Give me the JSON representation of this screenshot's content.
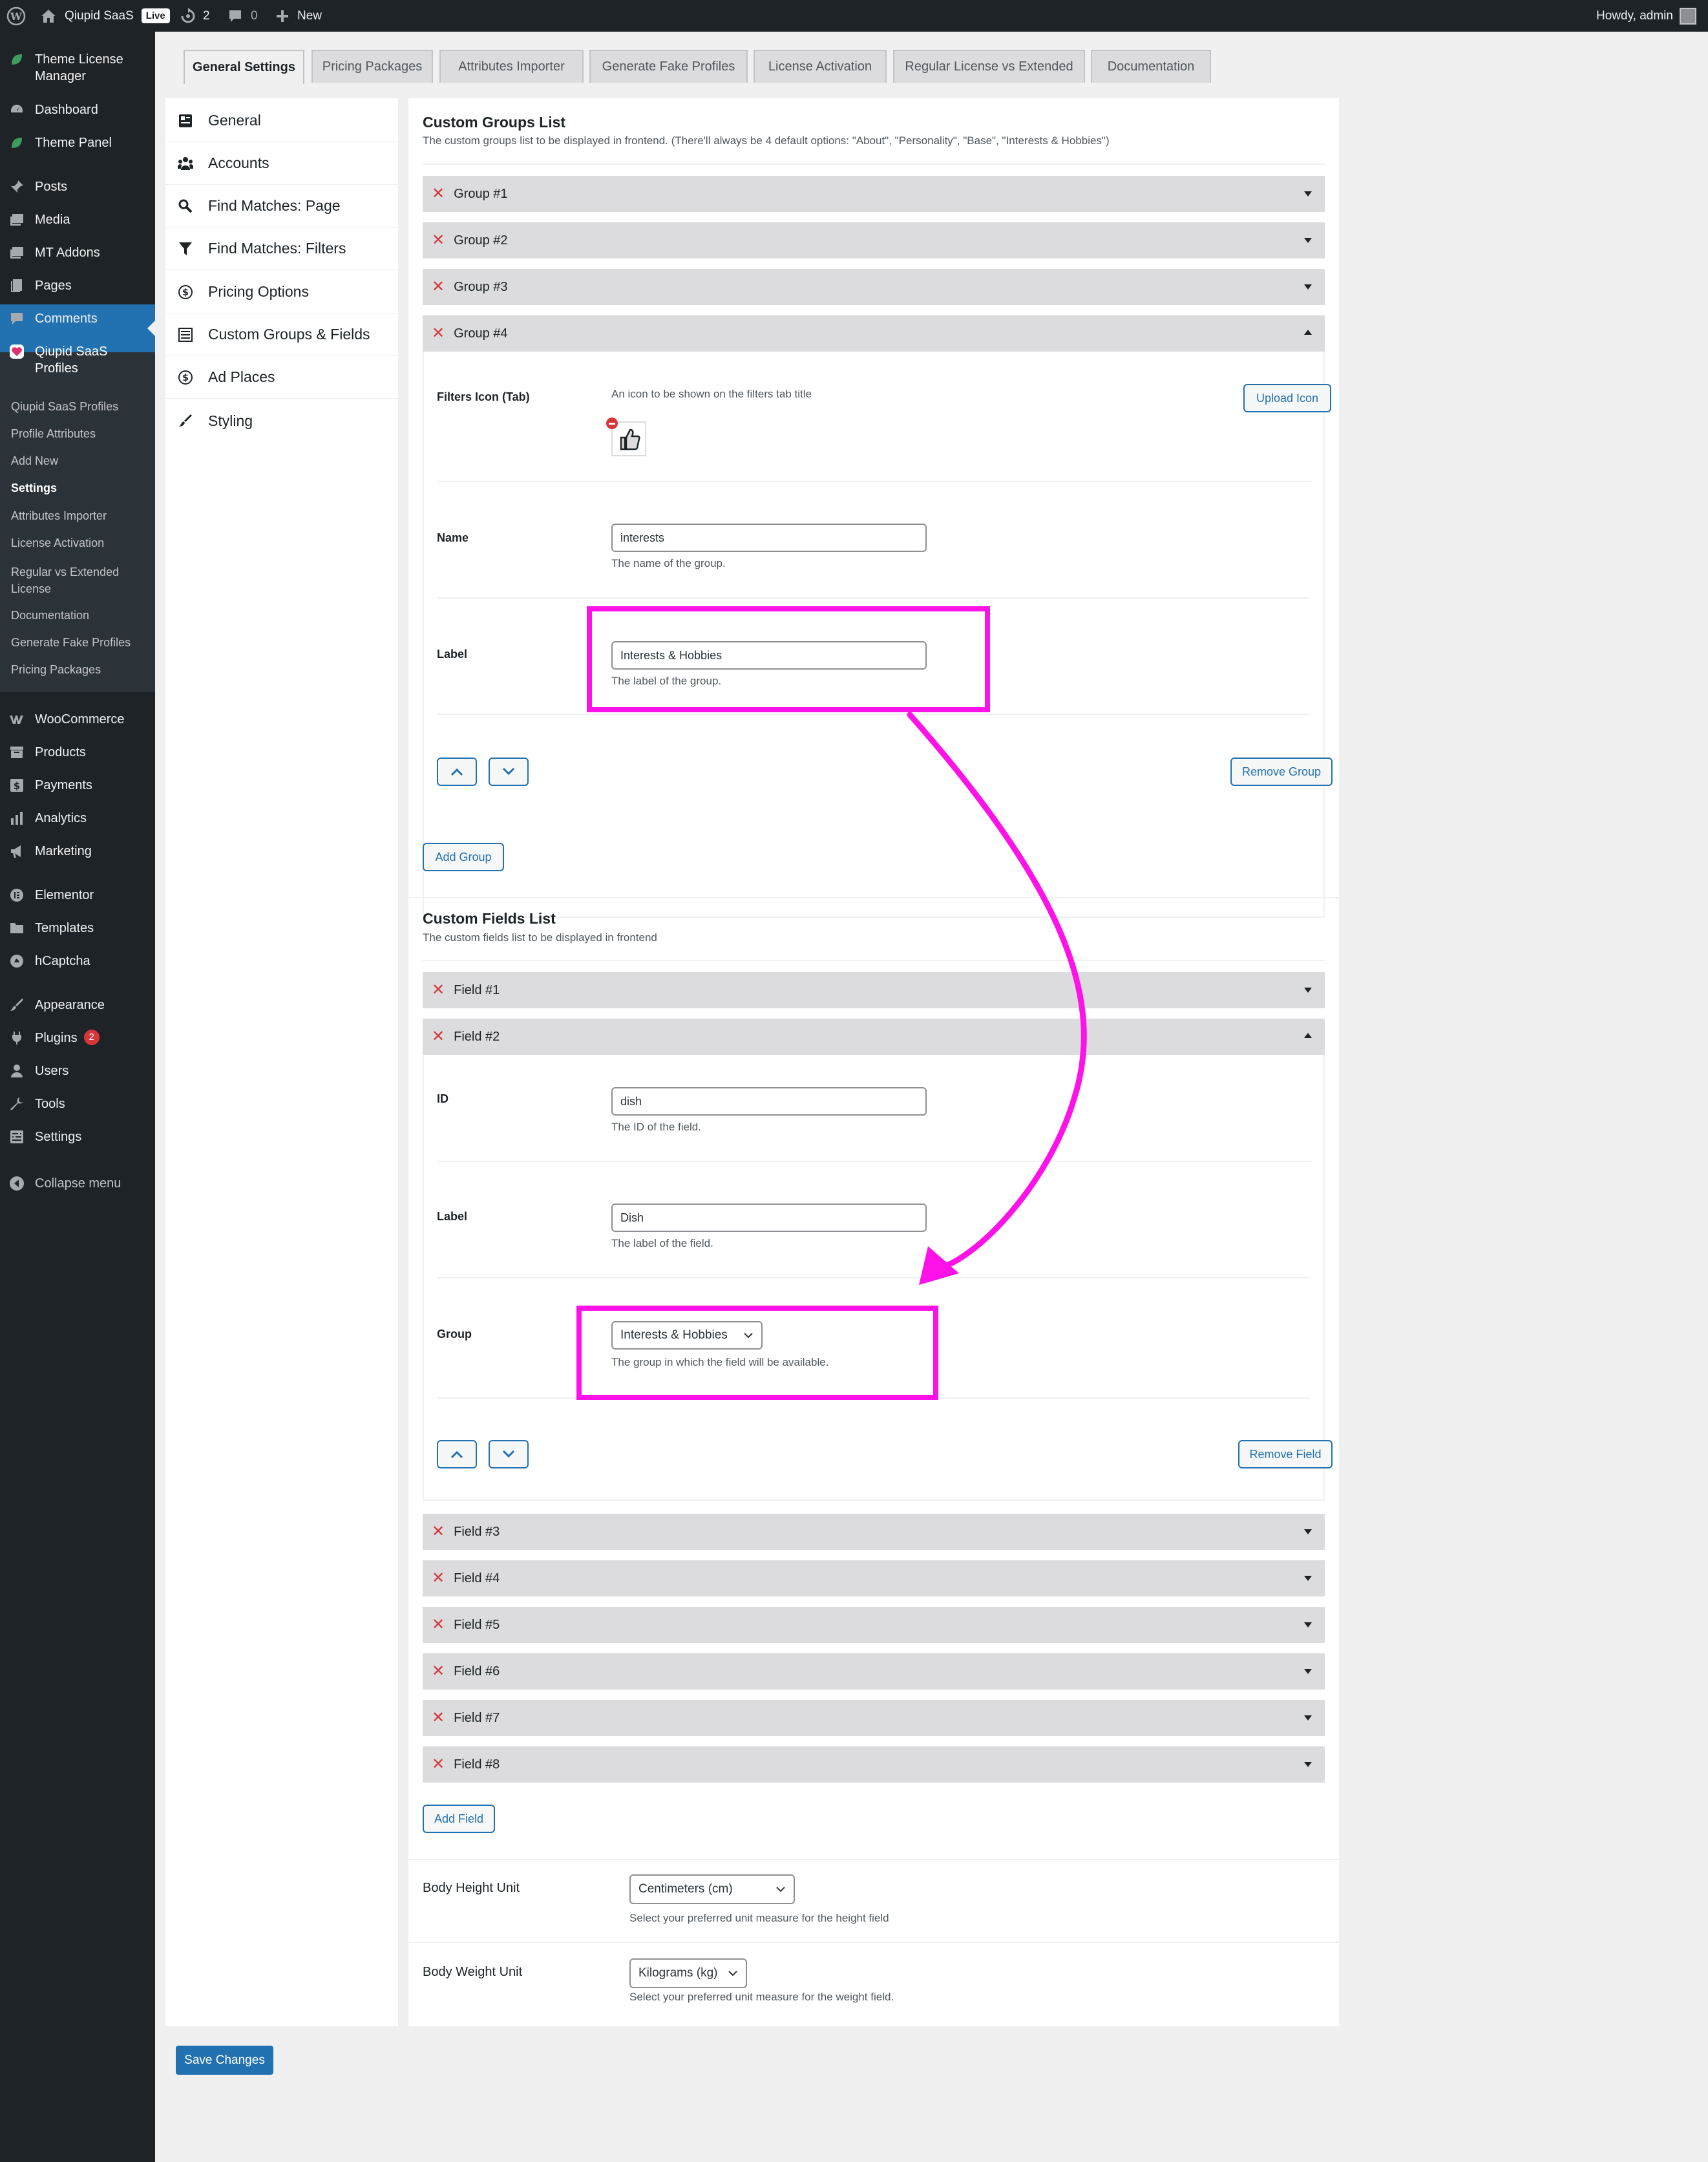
{
  "admin_bar": {
    "site_name": "Qiupid SaaS",
    "live_badge": "Live",
    "updates_count": "2",
    "comments_count": "0",
    "new_label": "New",
    "howdy": "Howdy, admin"
  },
  "sidebar": {
    "items": [
      {
        "label": "Theme License Manager",
        "icon": "leaf-icon"
      },
      {
        "label": "Dashboard",
        "icon": "dashboard-icon"
      },
      {
        "label": "Theme Panel",
        "icon": "leaf-icon"
      },
      {
        "label": "Posts",
        "icon": "pin-icon"
      },
      {
        "label": "Media",
        "icon": "media-icon"
      },
      {
        "label": "MT Addons",
        "icon": "media-icon"
      },
      {
        "label": "Pages",
        "icon": "page-icon"
      },
      {
        "label": "Comments",
        "icon": "comment-icon"
      },
      {
        "label": "Qiupid SaaS Profiles",
        "icon": "heart-icon"
      },
      {
        "label": "WooCommerce",
        "icon": "woo-icon"
      },
      {
        "label": "Products",
        "icon": "archive-icon"
      },
      {
        "label": "Payments",
        "icon": "dollar-icon"
      },
      {
        "label": "Analytics",
        "icon": "bar-chart-icon"
      },
      {
        "label": "Marketing",
        "icon": "megaphone-icon"
      },
      {
        "label": "Elementor",
        "icon": "elementor-icon"
      },
      {
        "label": "Templates",
        "icon": "folder-icon"
      },
      {
        "label": "hCaptcha",
        "icon": "hcaptcha-icon"
      },
      {
        "label": "Appearance",
        "icon": "brush-icon"
      },
      {
        "label": "Plugins",
        "icon": "plug-icon",
        "badge": "2"
      },
      {
        "label": "Users",
        "icon": "user-icon"
      },
      {
        "label": "Tools",
        "icon": "wrench-icon"
      },
      {
        "label": "Settings",
        "icon": "settings-icon"
      },
      {
        "label": "Collapse menu",
        "icon": "collapse-icon"
      }
    ],
    "submenu": [
      "Qiupid SaaS Profiles",
      "Profile Attributes",
      "Add New",
      "Settings",
      "Attributes Importer",
      "License Activation",
      "Regular vs Extended License",
      "Documentation",
      "Generate Fake Profiles",
      "Pricing Packages"
    ]
  },
  "tabs": [
    "General Settings",
    "Pricing Packages",
    "Attributes Importer",
    "Generate Fake Profiles",
    "License Activation",
    "Regular License vs Extended",
    "Documentation"
  ],
  "settings_nav": [
    {
      "label": "General",
      "icon": "general-icon"
    },
    {
      "label": "Accounts",
      "icon": "groups-icon"
    },
    {
      "label": "Find Matches: Page",
      "icon": "search-icon"
    },
    {
      "label": "Find Matches: Filters",
      "icon": "filter-icon"
    },
    {
      "label": "Pricing Options",
      "icon": "dollar-icon"
    },
    {
      "label": "Custom Groups & Fields",
      "icon": "list-icon"
    },
    {
      "label": "Ad Places",
      "icon": "dollar-icon"
    },
    {
      "label": "Styling",
      "icon": "brush-icon"
    }
  ],
  "groups_section": {
    "title": "Custom Groups List",
    "desc": "The custom groups list to be displayed in frontend. (There'll always be 4 default options: \"About\", \"Personality\", \"Base\", \"Interests & Hobbies\")",
    "groups": [
      "Group #1",
      "Group #2",
      "Group #3",
      "Group #4"
    ],
    "open": {
      "filters_icon_label": "Filters Icon (Tab)",
      "filters_icon_desc": "An icon to be shown on the filters tab title",
      "upload_icon": "Upload Icon",
      "name_label": "Name",
      "name_value": "interests",
      "name_desc": "The name of the group.",
      "label_label": "Label",
      "label_value": "Interests & Hobbies",
      "label_desc": "The label of the group.",
      "remove": "Remove Group"
    },
    "add": "Add Group"
  },
  "fields_section": {
    "title": "Custom Fields List",
    "desc": "The custom fields list to be displayed in frontend",
    "fields": [
      "Field #1",
      "Field #2",
      "Field #3",
      "Field #4",
      "Field #5",
      "Field #6",
      "Field #7",
      "Field #8"
    ],
    "open": {
      "id_label": "ID",
      "id_value": "dish",
      "id_desc": "The ID of the field.",
      "label_label": "Label",
      "label_value": "Dish",
      "label_desc": "The label of the field.",
      "group_label": "Group",
      "group_value": "Interests & Hobbies",
      "group_desc": "The group in which the field will be available.",
      "remove": "Remove Field"
    },
    "add": "Add Field"
  },
  "units": {
    "height_label": "Body Height Unit",
    "height_value": "Centimeters (cm)",
    "height_desc": "Select your preferred unit measure for the height field",
    "weight_label": "Body Weight Unit",
    "weight_value": "Kilograms (kg)",
    "weight_desc": "Select your preferred unit measure for the weight field."
  },
  "save": "Save Changes",
  "colors": {
    "highlight": "#ff12e8",
    "primary": "#2271b1",
    "delete": "#d63638"
  }
}
